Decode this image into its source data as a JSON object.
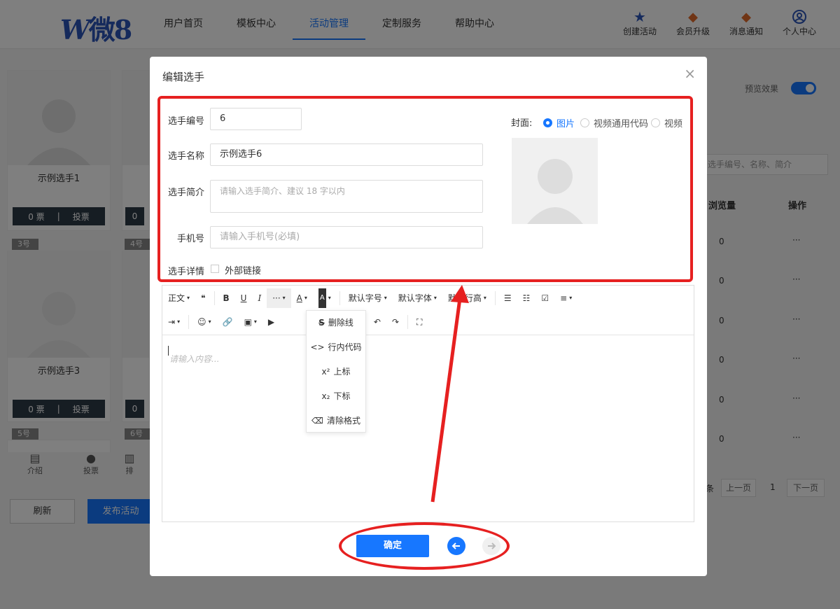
{
  "header": {
    "logo": "微8",
    "logo_w": "W",
    "nav": [
      "用户首页",
      "模板中心",
      "活动管理",
      "定制服务",
      "帮助中心"
    ],
    "active_nav": "活动管理",
    "icons": [
      {
        "label": "创建活动",
        "icon": "star-icon"
      },
      {
        "label": "会员升级",
        "icon": "diamond-icon"
      },
      {
        "label": "消息通知",
        "icon": "bell-icon"
      },
      {
        "label": "个人中心",
        "icon": "user-icon"
      }
    ]
  },
  "background": {
    "cards": [
      {
        "name": "示例选手1",
        "votes": "0 票",
        "vote_btn": "投票"
      },
      {
        "name": "示例选手3",
        "votes": "0 票",
        "vote_btn": "投票"
      }
    ],
    "badges": [
      "3号",
      "4号",
      "5号",
      "6号"
    ],
    "partial_votes": [
      "0",
      "0"
    ],
    "tabs": [
      "介绍",
      "投票",
      "排"
    ],
    "refresh": "刷新",
    "publish": "发布活动",
    "preview_label": "预览效果",
    "search_placeholder": "选手编号、名称、简介",
    "col_views": "浏览量",
    "col_ops": "操作",
    "rows": [
      "0",
      "0",
      "0",
      "0",
      "0",
      "0"
    ],
    "row_ops": "···",
    "pager": {
      "prev": "上一页",
      "page": "1",
      "next": "下一页",
      "fragment": "条"
    }
  },
  "modal": {
    "title": "编辑选手",
    "close": "×",
    "fields": {
      "number_label": "选手编号",
      "number_value": "6",
      "name_label": "选手名称",
      "name_value": "示例选手6",
      "intro_label": "选手简介",
      "intro_placeholder": "请输入选手简介、建议 18 字以内",
      "phone_label": "手机号",
      "phone_placeholder": "请输入手机号(必填)",
      "detail_label": "选手详情",
      "external_link": "外部链接"
    },
    "cover": {
      "label": "封面:",
      "options": [
        "图片",
        "视频通用代码",
        "视频"
      ],
      "selected": "图片"
    },
    "editor": {
      "toolbar1": [
        "正文",
        "❝",
        "B",
        "U",
        "I",
        "···",
        "A",
        "A",
        "默认字号",
        "默认字体",
        "默认行高"
      ],
      "placeholder": "请输入内容...",
      "dropdown": [
        "删除线",
        "行内代码",
        "上标",
        "下标",
        "清除格式"
      ]
    },
    "confirm": "确定"
  }
}
